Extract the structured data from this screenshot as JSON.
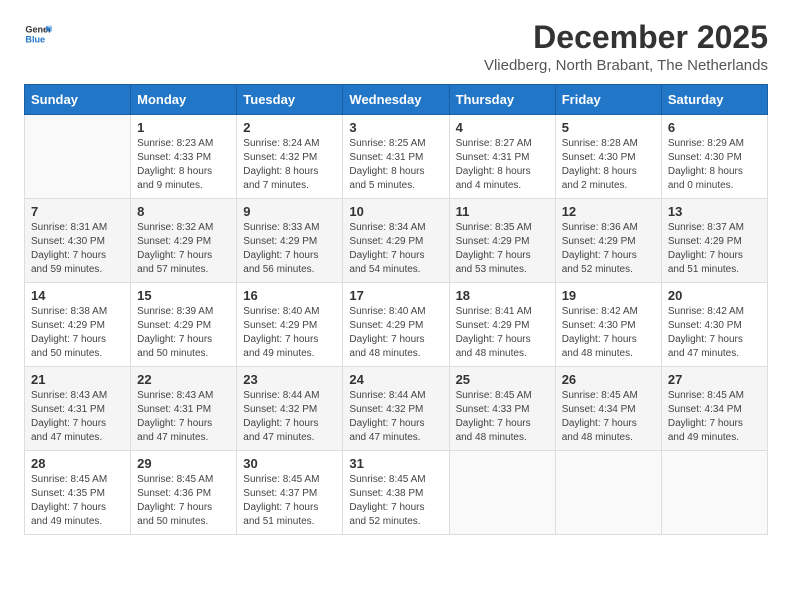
{
  "header": {
    "logo_general": "General",
    "logo_blue": "Blue",
    "month_title": "December 2025",
    "location": "Vliedberg, North Brabant, The Netherlands"
  },
  "weekdays": [
    "Sunday",
    "Monday",
    "Tuesday",
    "Wednesday",
    "Thursday",
    "Friday",
    "Saturday"
  ],
  "weeks": [
    [
      {
        "day": "",
        "sunrise": "",
        "sunset": "",
        "daylight": ""
      },
      {
        "day": "1",
        "sunrise": "Sunrise: 8:23 AM",
        "sunset": "Sunset: 4:33 PM",
        "daylight": "Daylight: 8 hours and 9 minutes."
      },
      {
        "day": "2",
        "sunrise": "Sunrise: 8:24 AM",
        "sunset": "Sunset: 4:32 PM",
        "daylight": "Daylight: 8 hours and 7 minutes."
      },
      {
        "day": "3",
        "sunrise": "Sunrise: 8:25 AM",
        "sunset": "Sunset: 4:31 PM",
        "daylight": "Daylight: 8 hours and 5 minutes."
      },
      {
        "day": "4",
        "sunrise": "Sunrise: 8:27 AM",
        "sunset": "Sunset: 4:31 PM",
        "daylight": "Daylight: 8 hours and 4 minutes."
      },
      {
        "day": "5",
        "sunrise": "Sunrise: 8:28 AM",
        "sunset": "Sunset: 4:30 PM",
        "daylight": "Daylight: 8 hours and 2 minutes."
      },
      {
        "day": "6",
        "sunrise": "Sunrise: 8:29 AM",
        "sunset": "Sunset: 4:30 PM",
        "daylight": "Daylight: 8 hours and 0 minutes."
      }
    ],
    [
      {
        "day": "7",
        "sunrise": "Sunrise: 8:31 AM",
        "sunset": "Sunset: 4:30 PM",
        "daylight": "Daylight: 7 hours and 59 minutes."
      },
      {
        "day": "8",
        "sunrise": "Sunrise: 8:32 AM",
        "sunset": "Sunset: 4:29 PM",
        "daylight": "Daylight: 7 hours and 57 minutes."
      },
      {
        "day": "9",
        "sunrise": "Sunrise: 8:33 AM",
        "sunset": "Sunset: 4:29 PM",
        "daylight": "Daylight: 7 hours and 56 minutes."
      },
      {
        "day": "10",
        "sunrise": "Sunrise: 8:34 AM",
        "sunset": "Sunset: 4:29 PM",
        "daylight": "Daylight: 7 hours and 54 minutes."
      },
      {
        "day": "11",
        "sunrise": "Sunrise: 8:35 AM",
        "sunset": "Sunset: 4:29 PM",
        "daylight": "Daylight: 7 hours and 53 minutes."
      },
      {
        "day": "12",
        "sunrise": "Sunrise: 8:36 AM",
        "sunset": "Sunset: 4:29 PM",
        "daylight": "Daylight: 7 hours and 52 minutes."
      },
      {
        "day": "13",
        "sunrise": "Sunrise: 8:37 AM",
        "sunset": "Sunset: 4:29 PM",
        "daylight": "Daylight: 7 hours and 51 minutes."
      }
    ],
    [
      {
        "day": "14",
        "sunrise": "Sunrise: 8:38 AM",
        "sunset": "Sunset: 4:29 PM",
        "daylight": "Daylight: 7 hours and 50 minutes."
      },
      {
        "day": "15",
        "sunrise": "Sunrise: 8:39 AM",
        "sunset": "Sunset: 4:29 PM",
        "daylight": "Daylight: 7 hours and 50 minutes."
      },
      {
        "day": "16",
        "sunrise": "Sunrise: 8:40 AM",
        "sunset": "Sunset: 4:29 PM",
        "daylight": "Daylight: 7 hours and 49 minutes."
      },
      {
        "day": "17",
        "sunrise": "Sunrise: 8:40 AM",
        "sunset": "Sunset: 4:29 PM",
        "daylight": "Daylight: 7 hours and 48 minutes."
      },
      {
        "day": "18",
        "sunrise": "Sunrise: 8:41 AM",
        "sunset": "Sunset: 4:29 PM",
        "daylight": "Daylight: 7 hours and 48 minutes."
      },
      {
        "day": "19",
        "sunrise": "Sunrise: 8:42 AM",
        "sunset": "Sunset: 4:30 PM",
        "daylight": "Daylight: 7 hours and 48 minutes."
      },
      {
        "day": "20",
        "sunrise": "Sunrise: 8:42 AM",
        "sunset": "Sunset: 4:30 PM",
        "daylight": "Daylight: 7 hours and 47 minutes."
      }
    ],
    [
      {
        "day": "21",
        "sunrise": "Sunrise: 8:43 AM",
        "sunset": "Sunset: 4:31 PM",
        "daylight": "Daylight: 7 hours and 47 minutes."
      },
      {
        "day": "22",
        "sunrise": "Sunrise: 8:43 AM",
        "sunset": "Sunset: 4:31 PM",
        "daylight": "Daylight: 7 hours and 47 minutes."
      },
      {
        "day": "23",
        "sunrise": "Sunrise: 8:44 AM",
        "sunset": "Sunset: 4:32 PM",
        "daylight": "Daylight: 7 hours and 47 minutes."
      },
      {
        "day": "24",
        "sunrise": "Sunrise: 8:44 AM",
        "sunset": "Sunset: 4:32 PM",
        "daylight": "Daylight: 7 hours and 47 minutes."
      },
      {
        "day": "25",
        "sunrise": "Sunrise: 8:45 AM",
        "sunset": "Sunset: 4:33 PM",
        "daylight": "Daylight: 7 hours and 48 minutes."
      },
      {
        "day": "26",
        "sunrise": "Sunrise: 8:45 AM",
        "sunset": "Sunset: 4:34 PM",
        "daylight": "Daylight: 7 hours and 48 minutes."
      },
      {
        "day": "27",
        "sunrise": "Sunrise: 8:45 AM",
        "sunset": "Sunset: 4:34 PM",
        "daylight": "Daylight: 7 hours and 49 minutes."
      }
    ],
    [
      {
        "day": "28",
        "sunrise": "Sunrise: 8:45 AM",
        "sunset": "Sunset: 4:35 PM",
        "daylight": "Daylight: 7 hours and 49 minutes."
      },
      {
        "day": "29",
        "sunrise": "Sunrise: 8:45 AM",
        "sunset": "Sunset: 4:36 PM",
        "daylight": "Daylight: 7 hours and 50 minutes."
      },
      {
        "day": "30",
        "sunrise": "Sunrise: 8:45 AM",
        "sunset": "Sunset: 4:37 PM",
        "daylight": "Daylight: 7 hours and 51 minutes."
      },
      {
        "day": "31",
        "sunrise": "Sunrise: 8:45 AM",
        "sunset": "Sunset: 4:38 PM",
        "daylight": "Daylight: 7 hours and 52 minutes."
      },
      {
        "day": "",
        "sunrise": "",
        "sunset": "",
        "daylight": ""
      },
      {
        "day": "",
        "sunrise": "",
        "sunset": "",
        "daylight": ""
      },
      {
        "day": "",
        "sunrise": "",
        "sunset": "",
        "daylight": ""
      }
    ]
  ]
}
